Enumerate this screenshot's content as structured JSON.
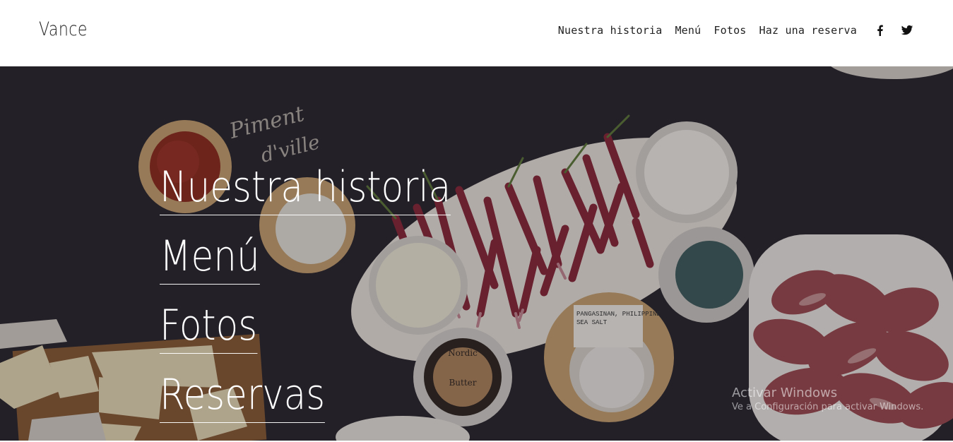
{
  "header": {
    "brand": "Vance",
    "nav": [
      "Nuestra historia",
      "Menú",
      "Fotos",
      "Haz una reserva"
    ],
    "social": [
      {
        "icon": "facebook-icon"
      },
      {
        "icon": "twitter-icon"
      }
    ]
  },
  "hero": {
    "items": [
      "Nuestra historia",
      "Menú",
      "Fotos",
      "Reservas"
    ],
    "chalk_text": [
      "Piment",
      "d'ville"
    ],
    "label_tag": [
      "PANGASINAN, PHILIPPINE",
      "SEA SALT"
    ],
    "butter_label": [
      "Nordic",
      "Butter"
    ]
  },
  "watermark": {
    "line1": "Activar Windows",
    "line2": "Ve a Configuración para activar Windows."
  },
  "colors": {
    "header_bg": "#ffffff",
    "hero_bg": "#2a2830",
    "text_light": "#ffffff",
    "text_dark": "#222222"
  }
}
